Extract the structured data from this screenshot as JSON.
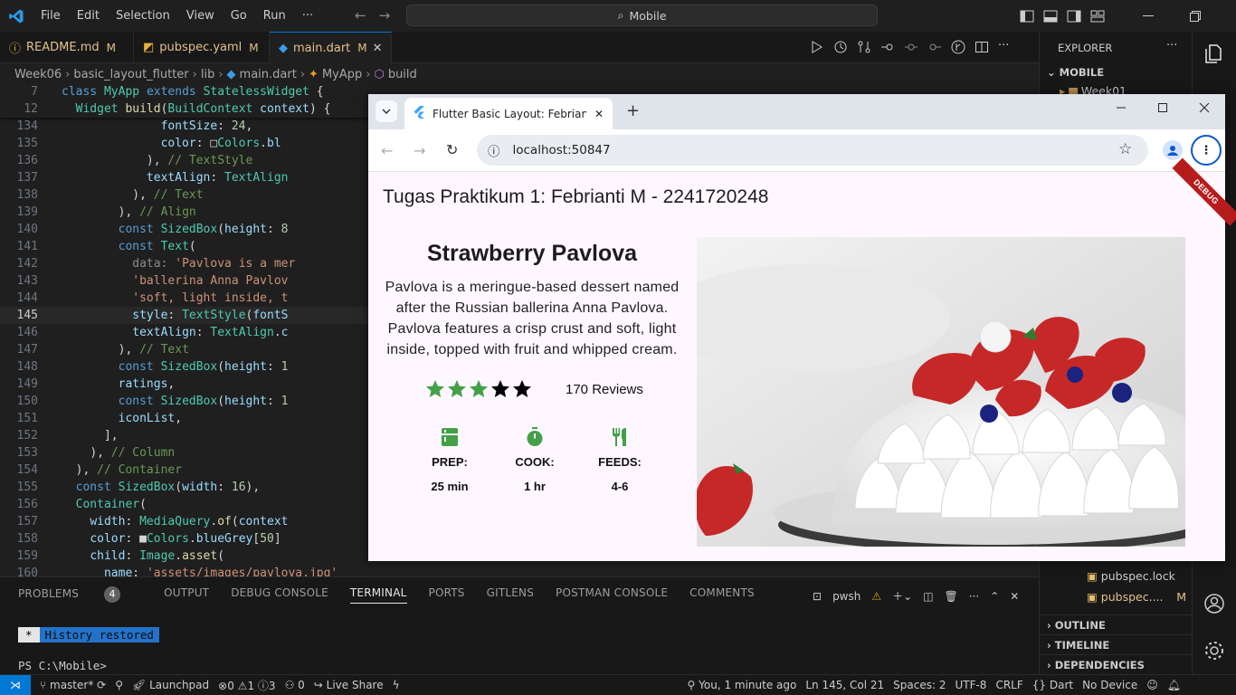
{
  "menu": [
    "File",
    "Edit",
    "Selection",
    "View",
    "Go",
    "Run",
    "···"
  ],
  "command_center": "Mobile",
  "tabs": [
    {
      "name": "README.md",
      "mark": "M"
    },
    {
      "name": "pubspec.yaml",
      "mark": "M"
    },
    {
      "name": "main.dart",
      "mark": "M"
    }
  ],
  "breadcrumb": [
    "Week06",
    "basic_layout_flutter",
    "lib",
    "main.dart",
    "MyApp",
    "build"
  ],
  "code_lines": [
    {
      "n": "7",
      "html": "<span class='k'>class</span> <span class='c'>MyApp</span> <span class='k'>extends</span> <span class='c'>StatelessWidget</span> <span class='w'>{</span>"
    },
    {
      "n": "12",
      "html": "  <span class='c'>Widget</span> <span class='f'>build</span><span class='w'>(</span><span class='c'>BuildContext</span> <span class='p'>context</span><span class='w'>) {</span>"
    },
    {
      "n": "134",
      "html": "              <span class='p'>fontSize</span><span class='w'>: </span><span class='n'>24</span><span class='w'>,</span>"
    },
    {
      "n": "135",
      "html": "              <span class='p'>color</span><span class='w'>: </span><span class='w'>□</span><span class='c'>Colors</span><span class='w'>.</span><span class='p'>bl</span>"
    },
    {
      "n": "136",
      "html": "            <span class='w'>), </span><span class='cm'>// TextStyle</span>"
    },
    {
      "n": "137",
      "html": "            <span class='p'>textAlign</span><span class='w'>: </span><span class='c'>TextAlign</span>"
    },
    {
      "n": "138",
      "html": "          <span class='w'>), </span><span class='cm'>// Text</span>"
    },
    {
      "n": "139",
      "html": "        <span class='w'>), </span><span class='cm'>// Align</span>"
    },
    {
      "n": "140",
      "html": "        <span class='k'>const</span> <span class='c'>SizedBox</span><span class='w'>(</span><span class='p'>height</span><span class='w'>: </span><span class='n'>8</span>"
    },
    {
      "n": "141",
      "html": "        <span class='k'>const</span> <span class='c'>Text</span><span class='w'>(</span>"
    },
    {
      "n": "142",
      "html": "          <span class='g'>data: </span><span class='s'>'Pavlova is a mer</span>"
    },
    {
      "n": "143",
      "html": "          <span class='s'>'ballerina Anna Pavlov</span>"
    },
    {
      "n": "144",
      "html": "          <span class='s'>'soft, light inside, t</span>"
    },
    {
      "n": "145",
      "html": "          <span class='p'>style</span><span class='w'>: </span><span class='c'>TextStyle</span><span class='w'>(</span><span class='p'>fontS</span>"
    },
    {
      "n": "146",
      "html": "          <span class='p'>textAlign</span><span class='w'>: </span><span class='c'>TextAlign</span><span class='w'>.</span><span class='p'>c</span>"
    },
    {
      "n": "147",
      "html": "        <span class='w'>), </span><span class='cm'>// Text</span>"
    },
    {
      "n": "148",
      "html": "        <span class='k'>const</span> <span class='c'>SizedBox</span><span class='w'>(</span><span class='p'>height</span><span class='w'>: </span><span class='n'>1</span>"
    },
    {
      "n": "149",
      "html": "        <span class='p'>ratings</span><span class='w'>,</span>"
    },
    {
      "n": "150",
      "html": "        <span class='k'>const</span> <span class='c'>SizedBox</span><span class='w'>(</span><span class='p'>height</span><span class='w'>: </span><span class='n'>1</span>"
    },
    {
      "n": "151",
      "html": "        <span class='p'>iconList</span><span class='w'>,</span>"
    },
    {
      "n": "152",
      "html": "      <span class='w'>],</span>"
    },
    {
      "n": "153",
      "html": "    <span class='w'>), </span><span class='cm'>// Column</span>"
    },
    {
      "n": "154",
      "html": "  <span class='w'>), </span><span class='cm'>// Container</span>"
    },
    {
      "n": "155",
      "html": "  <span class='k'>const</span> <span class='c'>SizedBox</span><span class='w'>(</span><span class='p'>width</span><span class='w'>: </span><span class='n'>16</span><span class='w'>),</span>"
    },
    {
      "n": "156",
      "html": "  <span class='c'>Container</span><span class='w'>(</span>"
    },
    {
      "n": "157",
      "html": "    <span class='p'>width</span><span class='w'>: </span><span class='c'>MediaQuery</span><span class='w'>.</span><span class='f'>of</span><span class='w'>(</span><span class='p'>context</span>"
    },
    {
      "n": "158",
      "html": "    <span class='p'>color</span><span class='w'>: </span><span class='w'>■</span><span class='c'>Colors</span><span class='w'>.</span><span class='p'>blueGrey</span><span class='w'>[</span><span class='n'>50</span><span class='w'>]</span>"
    },
    {
      "n": "159",
      "html": "    <span class='p'>child</span><span class='w'>: </span><span class='c'>Image</span><span class='w'>.</span><span class='f'>asset</span><span class='w'>(</span>"
    },
    {
      "n": "160",
      "html": "      <span class='p'>name</span><span class='w'>: </span><span class='s'>'assets/images/pavlova.jpg'</span>"
    }
  ],
  "panel": {
    "tabs": [
      "PROBLEMS",
      "OUTPUT",
      "DEBUG CONSOLE",
      "TERMINAL",
      "PORTS",
      "GITLENS",
      "POSTMAN CONSOLE",
      "COMMENTS"
    ],
    "problems_count": "4",
    "shell": "pwsh",
    "history_star": "*",
    "history_msg": "History restored",
    "prompt": "PS C:\\Mobile>"
  },
  "explorer": {
    "title": "EXPLORER",
    "root": "MOBILE",
    "first_item": "Week01",
    "files": [
      {
        "name": "pubspec.lock",
        "mark": ""
      },
      {
        "name": "pubspec....",
        "mark": "M"
      }
    ],
    "sections": [
      "OUTLINE",
      "TIMELINE",
      "DEPENDENCIES"
    ]
  },
  "status": {
    "branch": "master*",
    "launchpad": "Launchpad",
    "errors": "0",
    "warnings": "1",
    "info": "3",
    "ports": "0",
    "liveshare": "Live Share",
    "blame": "You, 1 minute ago",
    "position": "Ln 145, Col 21",
    "spaces": "Spaces: 2",
    "encoding": "UTF-8",
    "eol": "CRLF",
    "language": "Dart",
    "device": "No Device"
  },
  "browser": {
    "tab_title": "Flutter Basic Layout: Febrianti M",
    "url": "localhost:50847"
  },
  "app": {
    "title": "Tugas Praktikum 1: Febrianti M - 2241720248",
    "debug": "DEBUG",
    "recipe_title": "Strawberry Pavlova",
    "description": "Pavlova is a meringue-based dessert named after the Russian ballerina Anna Pavlova. Pavlova features a crisp crust and soft, light inside, topped with fruit and whipped cream.",
    "rating": 3,
    "rating_max": 5,
    "reviews": "170 Reviews",
    "info": [
      {
        "label": "PREP:",
        "value": "25 min",
        "icon": "kitchen-icon"
      },
      {
        "label": "COOK:",
        "value": "1 hr",
        "icon": "timer-icon"
      },
      {
        "label": "FEEDS:",
        "value": "4-6",
        "icon": "restaurant-icon"
      }
    ],
    "star_color_on": "#43a047",
    "star_color_off": "#000000"
  }
}
